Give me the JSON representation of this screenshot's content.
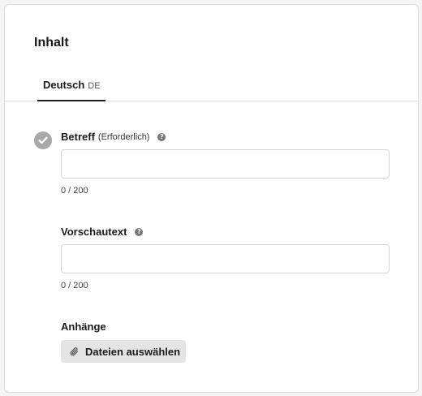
{
  "section": {
    "title": "Inhalt"
  },
  "tabs": [
    {
      "label": "Deutsch",
      "code": "DE"
    }
  ],
  "subject": {
    "label": "Betreff",
    "required_hint": "(Erforderlich)",
    "value": "",
    "counter": "0 / 200"
  },
  "preview": {
    "label": "Vorschautext",
    "value": "",
    "counter": "0 / 200"
  },
  "attachments": {
    "label": "Anhänge",
    "button_label": "Dateien auswählen"
  },
  "icons": {
    "status": "checkmark-circle-icon",
    "help": "question-circle-icon",
    "attach": "paperclip-icon"
  },
  "colors": {
    "accent": "#1a1a1a",
    "muted_check": "#a8a8a8",
    "button_bg": "#e4e4e4"
  }
}
